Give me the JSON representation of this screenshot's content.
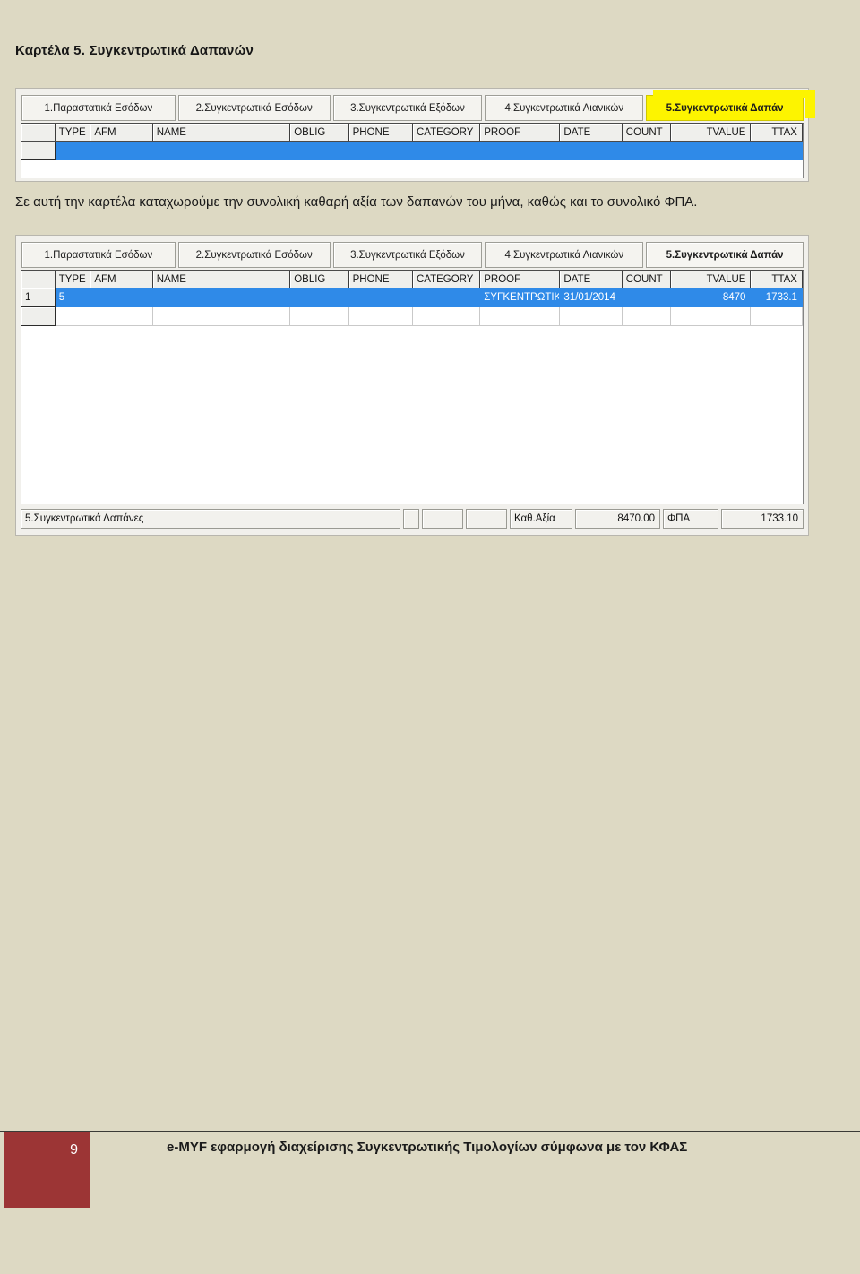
{
  "page": {
    "title": "Καρτέλα  5. Συγκεντρωτικά Δαπανών",
    "body_text": "Σε αυτή την καρτέλα καταχωρούμε την συνολική καθαρή αξία των δαπανών του μήνα, καθώς και το συνολικό ΦΠΑ.",
    "background_color": "#ddd9c3",
    "highlight_color": "#fdf400",
    "selection_color": "#2f8ae8"
  },
  "footer": {
    "page_number": "9",
    "text": "e-MYF εφαρμογή διαχείρισης Συγκεντρωτικής Τιμολογίων σύμφωνα με τον ΚΦΑΣ",
    "badge_color": "#9c3535"
  },
  "screenshot_1": {
    "tabs": [
      {
        "label": "1.Παραστατικά Εσόδων",
        "active": false,
        "highlighted": false
      },
      {
        "label": "2.Συγκεντρωτικά Εσόδων",
        "active": false,
        "highlighted": false
      },
      {
        "label": "3.Συγκεντρωτικά Εξόδων",
        "active": false,
        "highlighted": false
      },
      {
        "label": "4.Συγκεντρωτικά Λιανικών",
        "active": false,
        "highlighted": false
      },
      {
        "label": "5.Συγκεντρωτικά Δαπάν",
        "active": true,
        "highlighted": true
      }
    ],
    "grid": {
      "columns": [
        "",
        "TYPE",
        "AFM",
        "NAME",
        "OBLIG",
        "PHONE",
        "CATEGORY",
        "PROOF",
        "DATE",
        "COUNT",
        "TVALUE",
        "TTAX"
      ],
      "rows": [
        {
          "selected": true,
          "cells": [
            "",
            "",
            "",
            "",
            "",
            "",
            "",
            "",
            "",
            "",
            "",
            ""
          ]
        }
      ]
    }
  },
  "screenshot_2": {
    "tabs": [
      {
        "label": "1.Παραστατικά Εσόδων",
        "active": false,
        "highlighted": false
      },
      {
        "label": "2.Συγκεντρωτικά Εσόδων",
        "active": false,
        "highlighted": false
      },
      {
        "label": "3.Συγκεντρωτικά Εξόδων",
        "active": false,
        "highlighted": false
      },
      {
        "label": "4.Συγκεντρωτικά Λιανικών",
        "active": false,
        "highlighted": false
      },
      {
        "label": "5.Συγκεντρωτικά Δαπάν",
        "active": true,
        "highlighted": false
      }
    ],
    "grid": {
      "columns": [
        "",
        "TYPE",
        "AFM",
        "NAME",
        "OBLIG",
        "PHONE",
        "CATEGORY",
        "PROOF",
        "DATE",
        "COUNT",
        "TVALUE",
        "TTAX"
      ],
      "rows": [
        {
          "selected": true,
          "cells": [
            "1",
            "5",
            "",
            "",
            "",
            "",
            "",
            "ΣΥΓΚΕΝΤΡΩΤΙΚΑ",
            "31/01/2014",
            "",
            "8470",
            "1733.1"
          ]
        },
        {
          "selected": false,
          "cells": [
            "",
            "",
            "",
            "",
            "",
            "",
            "",
            "",
            "",
            "",
            "",
            ""
          ]
        }
      ]
    },
    "statusbar": {
      "tab_name": "5.Συγκεντρωτικά Δαπάνες",
      "spacer_1": "",
      "spacer_2": "",
      "spacer_3": "",
      "net_label": "Καθ.Αξία",
      "net_value": "8470.00",
      "vat_label": "ΦΠΑ",
      "vat_value": "1733.10"
    }
  }
}
